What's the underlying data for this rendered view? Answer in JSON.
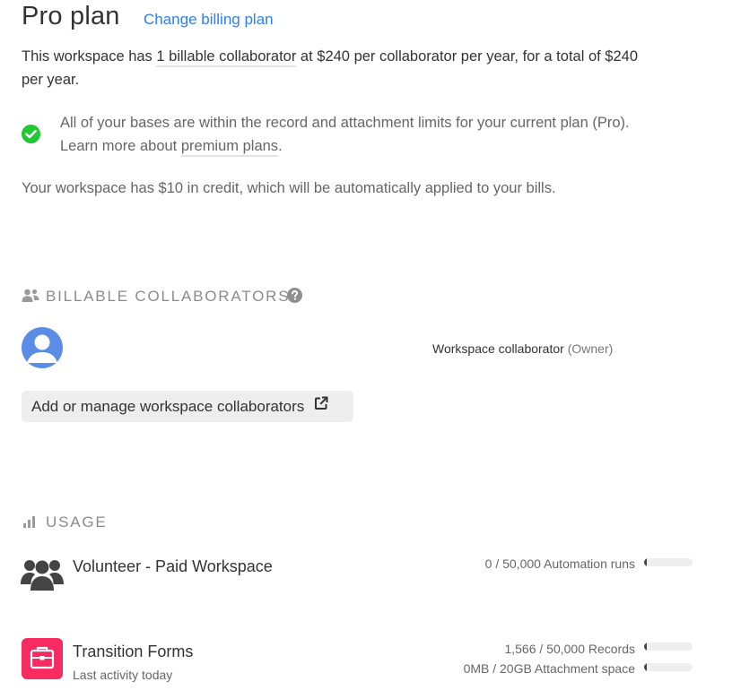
{
  "plan": {
    "title": "Pro plan",
    "change_link": "Change billing plan"
  },
  "billing": {
    "prefix": "This workspace has ",
    "collaborators_link": "1 billable collaborator",
    "suffix_line1": " at $240 per collaborator per year, for a total of $240",
    "suffix_line2": "per year."
  },
  "limits": {
    "line1": "All of your bases are within the record and attachment limits for your current plan (Pro).",
    "line2_prefix": "Learn more about ",
    "premium_link": "premium plans",
    "line2_suffix": "."
  },
  "credit": "Your workspace has $10 in credit, which will be automatically applied to your bills.",
  "collaborators_section": {
    "heading": "BILLABLE COLLABORATORS",
    "member_role": "Workspace collaborator",
    "member_permission": "(Owner)",
    "manage_button": "Add or manage workspace collaborators"
  },
  "usage_section": {
    "heading": "USAGE",
    "workspace": {
      "name": "Volunteer - Paid Workspace",
      "automation_runs": "0 / 50,000 Automation runs",
      "automation_fraction": 0.0
    },
    "base": {
      "name": "Transition Forms",
      "activity": "Last activity today",
      "records": "1,566 / 50,000 Records",
      "records_fraction": 0.031,
      "attachments": "0MB / 20GB Attachment space",
      "attachments_fraction": 0.0
    }
  },
  "colors": {
    "link": "#2d7ff9",
    "check": "#20c933",
    "avatar": "#5b8ce6",
    "base_icon": "#f82b60"
  }
}
